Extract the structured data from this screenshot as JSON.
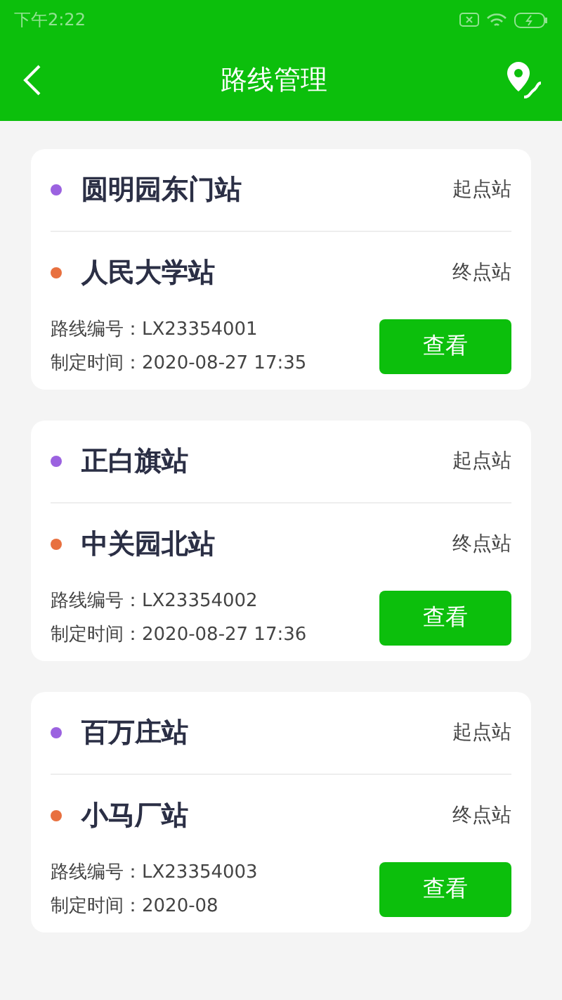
{
  "status_bar": {
    "time": "下午2:22"
  },
  "header": {
    "title": "路线管理"
  },
  "routes": [
    {
      "stops": [
        {
          "name": "圆明园东门站",
          "role": "起点站",
          "color": "#9b62e0"
        },
        {
          "name": "人民大学站",
          "role": "终点站",
          "color": "#e8703f"
        }
      ],
      "code": "路线编号：LX23354001",
      "time": "制定时间：2020-08-27 17:35",
      "button": "查看"
    },
    {
      "stops": [
        {
          "name": "正白旗站",
          "role": "起点站",
          "color": "#9b62e0"
        },
        {
          "name": "中关园北站",
          "role": "终点站",
          "color": "#e8703f"
        }
      ],
      "code": "路线编号：LX23354002",
      "time": "制定时间：2020-08-27 17:36",
      "button": "查看"
    },
    {
      "stops": [
        {
          "name": "百万庄站",
          "role": "起点站",
          "color": "#9b62e0"
        },
        {
          "name": "小马厂站",
          "role": "终点站",
          "color": "#e8703f"
        }
      ],
      "code": "路线编号：LX23354003",
      "time": "制定时间：2020-08",
      "button": "查看"
    }
  ]
}
